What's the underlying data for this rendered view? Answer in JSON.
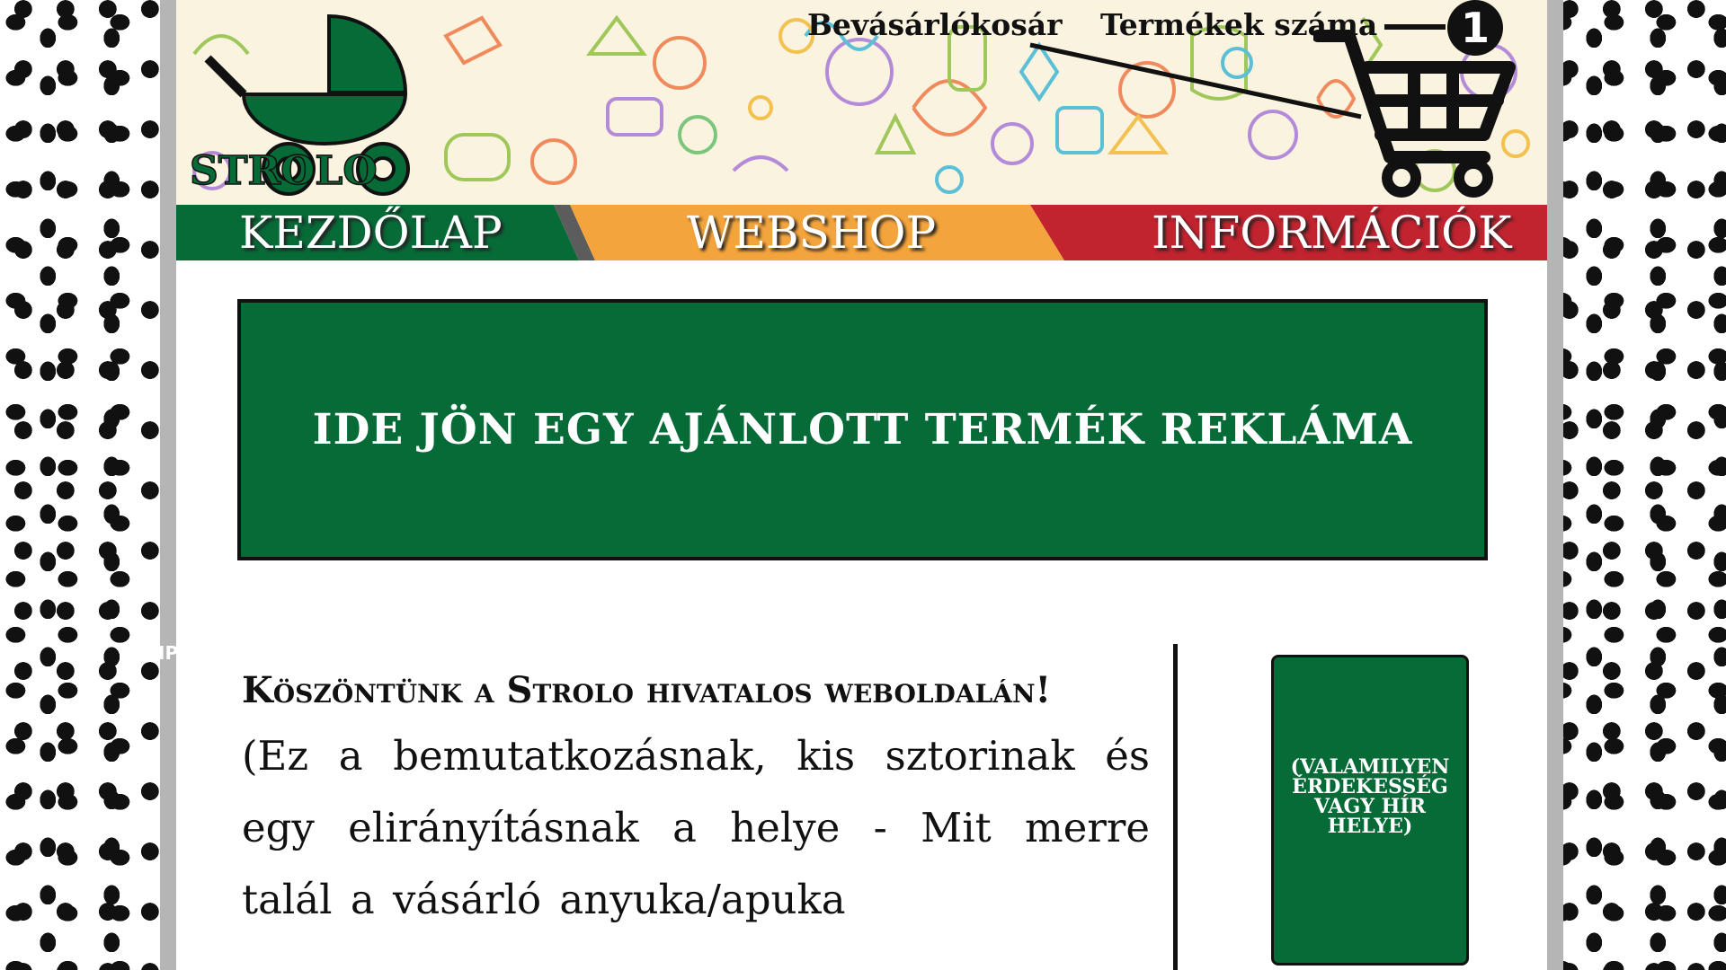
{
  "header": {
    "logo_text": "STROLO",
    "cart_label": "Bevásárlókosár",
    "count_label": "Termékek száma",
    "cart_count": "1"
  },
  "nav": {
    "items": [
      {
        "label": "KEZDŐLAP",
        "color": "#076b38"
      },
      {
        "label": "WEBSHOP",
        "color": "#f4a43c"
      },
      {
        "label": "INFORMÁCIÓK",
        "color": "#c1232f"
      }
    ]
  },
  "hero": {
    "text": "IDE JÖN EGY AJÁNLOTT TERMÉK REKLÁMA"
  },
  "welcome": {
    "title": "Köszöntünk a Strolo hivatalos weboldalán!",
    "body": "(Ez a bemutatkozásnak, kis sztorinak és egy elirányításnak a helye - Mit merre talál a vásárló anyuka/apuka"
  },
  "news": {
    "text": "(VALAMILYEN ÉRDEKESSÉG VAGY HÍR HELYE)"
  },
  "side_fragment": "IP",
  "colors": {
    "brand_green": "#076b38",
    "orange": "#f4a43c",
    "red": "#c1232f",
    "frame_gray": "#b5b5b5",
    "header_bg": "#faf3df"
  }
}
